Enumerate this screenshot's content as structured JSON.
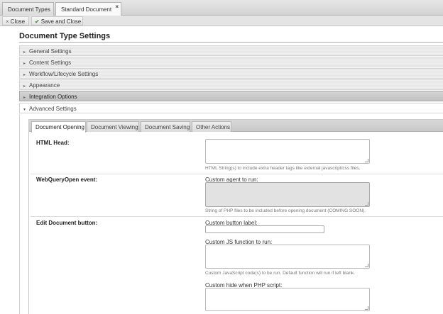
{
  "tabs": [
    {
      "label": "Document Types"
    },
    {
      "label": "Standard Document",
      "close": "×"
    }
  ],
  "toolbar": {
    "close_label": "Close",
    "close_icon": "×",
    "save_label": "Save and Close",
    "save_icon": "✔"
  },
  "page_title": "Document Type Settings",
  "sections": [
    {
      "label": "General Settings",
      "state": "collapsed"
    },
    {
      "label": "Content Settings",
      "state": "collapsed"
    },
    {
      "label": "Workflow/Lifecycle Settings",
      "state": "collapsed"
    },
    {
      "label": "Appearance",
      "state": "collapsed"
    },
    {
      "label": "Integration Options",
      "state": "collapsed-highlighted"
    },
    {
      "label": "Advanced Settings",
      "state": "expanded"
    }
  ],
  "arrows": {
    "collapsed": "▸",
    "expanded": "▾"
  },
  "advanced": {
    "subtabs": [
      {
        "label": "Document Opening",
        "active": true
      },
      {
        "label": "Document Viewing"
      },
      {
        "label": "Document Saving"
      },
      {
        "label": "Other Actions"
      }
    ],
    "fields": {
      "html_head": {
        "label": "HTML Head:",
        "value": "",
        "help": "HTML String(s) to include extra header tags like external javascript/css files."
      },
      "webqueryopen": {
        "label": "WebQueryOpen event:",
        "sublabel": "Custom agent to run:",
        "value": "",
        "help": "String of PHP files to be included before opening document (COMING SOON)."
      },
      "edit_button": {
        "label": "Edit Document button:",
        "custom_label_label": "Custom button label:",
        "custom_label_value": "",
        "js_label": "Custom JS function to run:",
        "js_value": "",
        "js_help": "Custom JavaScript code(s) to be run. Default function will run if left blank.",
        "hide_label": "Custom hide when PHP script:",
        "hide_value": ""
      }
    }
  },
  "colors": {
    "highlight_section": "#c6c6c6",
    "disabled_field": "#e2e2e2",
    "save_check": "#3c7d2a"
  }
}
